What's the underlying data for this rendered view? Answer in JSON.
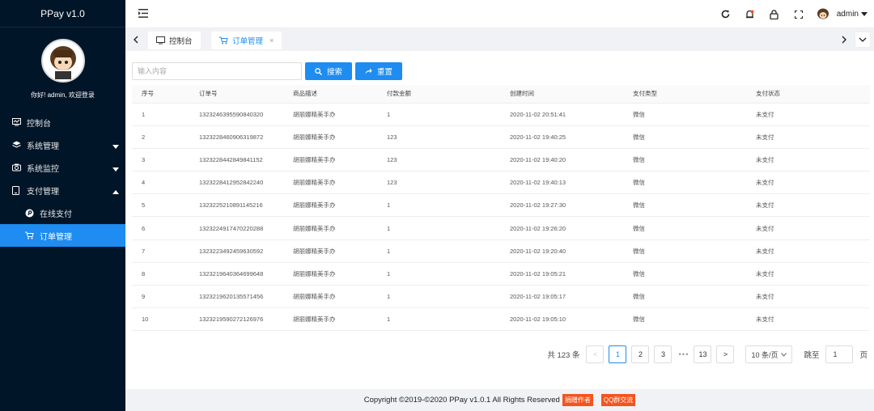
{
  "app": {
    "brand": "PPay v1.0",
    "welcome": "你好! admin, 欢迎登录"
  },
  "sidebar": {
    "items": [
      {
        "label": "控制台",
        "icon": "monitor-icon"
      },
      {
        "label": "系统管理",
        "icon": "layers-icon"
      },
      {
        "label": "系统监控",
        "icon": "camera-icon"
      },
      {
        "label": "支付管理",
        "icon": "phone-icon"
      }
    ],
    "sub_items": [
      {
        "label": "在线支付",
        "icon": "paypal-icon"
      },
      {
        "label": "订单管理",
        "icon": "cart-icon"
      }
    ]
  },
  "header": {
    "username": "admin"
  },
  "tabs": [
    {
      "label": "控制台",
      "icon": "monitor-icon"
    },
    {
      "label": "订单管理",
      "icon": "cart-icon",
      "close": "×"
    }
  ],
  "search": {
    "placeholder": "输入内容",
    "search_label": "搜索",
    "reset_label": "重置"
  },
  "table": {
    "headers": [
      "序号",
      "订单号",
      "商品描述",
      "付款金额",
      "创建时间",
      "支付类型",
      "支付状态"
    ],
    "rows": [
      [
        "1",
        "1323246395590840320",
        "胡丽娜精美手办",
        "1",
        "2020-11-02 20:51:41",
        "微信",
        "未支付"
      ],
      [
        "2",
        "1323228460906319872",
        "胡丽娜精美手办",
        "123",
        "2020-11-02 19:40:25",
        "微信",
        "未支付"
      ],
      [
        "3",
        "1323228442849841152",
        "胡丽娜精美手办",
        "123",
        "2020-11-02 19:40:20",
        "微信",
        "未支付"
      ],
      [
        "4",
        "1323228412952842240",
        "胡丽娜精美手办",
        "123",
        "2020-11-02 19:40:13",
        "微信",
        "未支付"
      ],
      [
        "5",
        "1323225210891145216",
        "胡丽娜精美手办",
        "1",
        "2020-11-02 19:27:30",
        "微信",
        "未支付"
      ],
      [
        "6",
        "1323224917470220288",
        "胡丽娜精美手办",
        "1",
        "2020-11-02 19:26:20",
        "微信",
        "未支付"
      ],
      [
        "7",
        "1323223492459630592",
        "胡丽娜精美手办",
        "1",
        "2020-11-02 19:20:40",
        "微信",
        "未支付"
      ],
      [
        "8",
        "1323219640364699648",
        "胡丽娜精美手办",
        "1",
        "2020-11-02 19:05:21",
        "微信",
        "未支付"
      ],
      [
        "9",
        "1323219620135571456",
        "胡丽娜精美手办",
        "1",
        "2020-11-02 19:05:17",
        "微信",
        "未支付"
      ],
      [
        "10",
        "1323219590272126976",
        "胡丽娜精美手办",
        "1",
        "2020-11-02 19:05:10",
        "微信",
        "未支付"
      ]
    ]
  },
  "pagination": {
    "total_label": "共 123 条",
    "prev": "<",
    "pages": [
      "1",
      "2",
      "3"
    ],
    "more": "•••",
    "last": "13",
    "next": ">",
    "page_size": "10 条/页",
    "jump_label": "跳至",
    "jump_value": "1",
    "page_suffix": "页"
  },
  "footer": {
    "copyright": "Copyright ©2019-©2020 PPay v1.0.1 All Rights Reserved",
    "donate": "捐赠作者",
    "qq": "QQ群交流"
  },
  "colors": {
    "sidebar_bg": "#011528",
    "primary": "#1e8cf0",
    "badge": "#f5541e"
  }
}
